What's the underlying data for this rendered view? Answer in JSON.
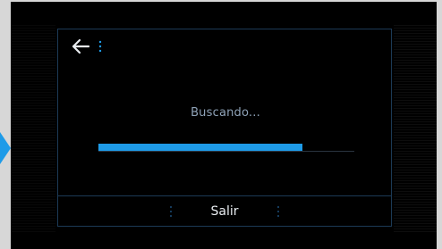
{
  "dialog": {
    "status_text": "Buscando...",
    "progress_percent": 85,
    "exit_label": "Salir"
  },
  "icons": {
    "back": "arrow-left-icon",
    "menu": "vertical-dots-icon"
  },
  "colors": {
    "accent": "#1e9be8",
    "panel_border": "#1c3a56",
    "status_text": "#8fa3b8",
    "button_text": "#e8ecf0",
    "background": "#000000"
  }
}
